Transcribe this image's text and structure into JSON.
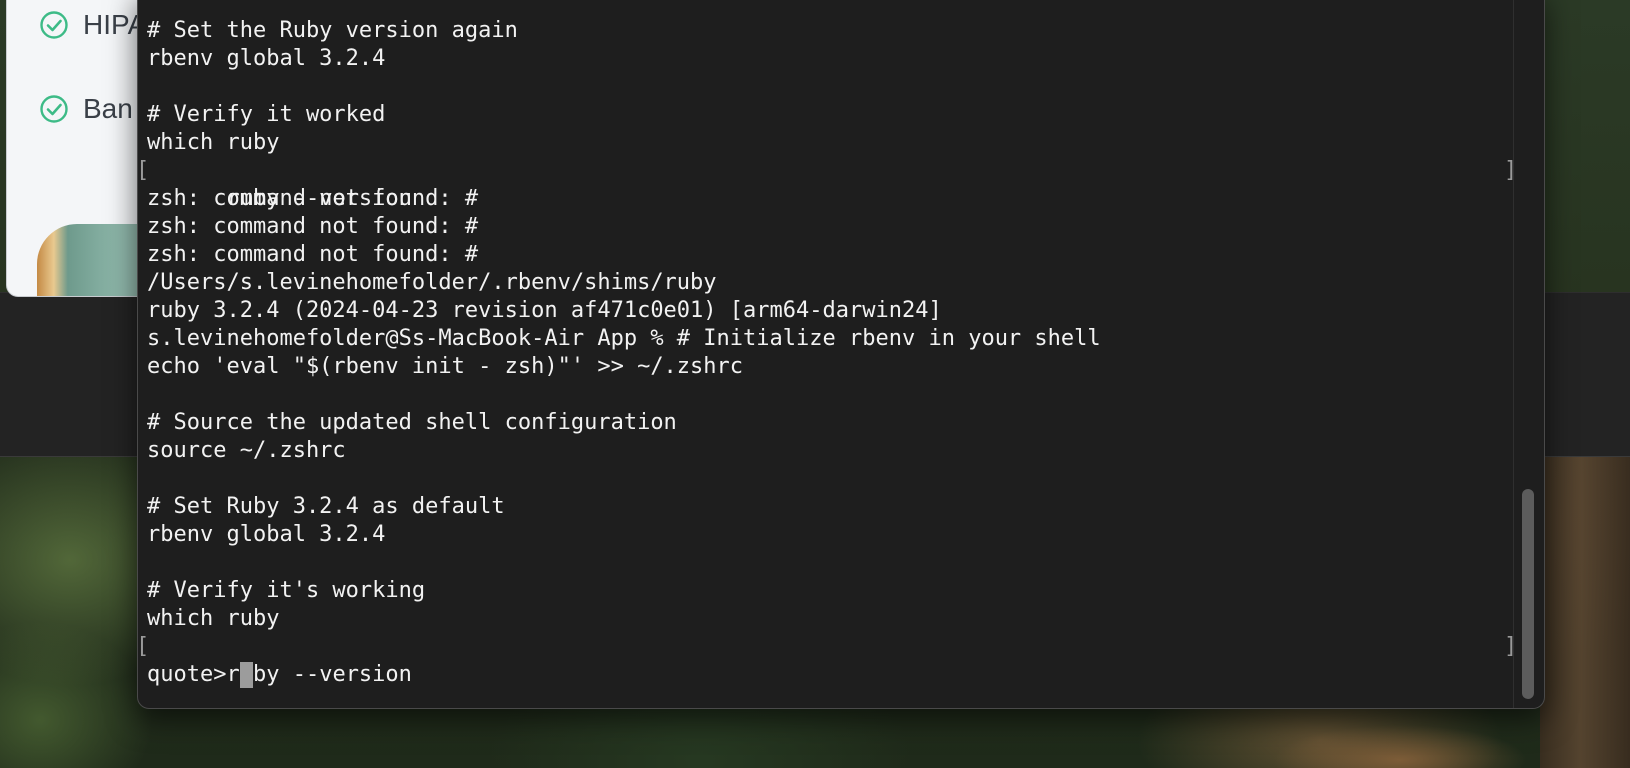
{
  "background_app": {
    "items": [
      {
        "label": "HIPA",
        "icon": "check-circle-icon"
      },
      {
        "label": "Ban",
        "icon": "check-circle-icon"
      }
    ],
    "accent_color": "#3dbb87"
  },
  "terminal": {
    "lines": [
      {
        "text": "# Set the Ruby version again"
      },
      {
        "text": "rbenv global 3.2.4"
      },
      {
        "text": ""
      },
      {
        "text": "# Verify it worked"
      },
      {
        "text": "which ruby"
      },
      {
        "text": "ruby --version",
        "marked": true
      },
      {
        "text": "zsh: command not found: #"
      },
      {
        "text": "zsh: command not found: #"
      },
      {
        "text": "zsh: command not found: #"
      },
      {
        "text": "/Users/s.levinehomefolder/.rbenv/shims/ruby"
      },
      {
        "text": "ruby 3.2.4 (2024-04-23 revision af471c0e01) [arm64-darwin24]"
      },
      {
        "text": "s.levinehomefolder@Ss-MacBook-Air App % # Initialize rbenv in your shell"
      },
      {
        "text": "echo 'eval \"$(rbenv init - zsh)\"' >> ~/.zshrc"
      },
      {
        "text": ""
      },
      {
        "text": "# Source the updated shell configuration"
      },
      {
        "text": "source ~/.zshrc"
      },
      {
        "text": ""
      },
      {
        "text": "# Set Ruby 3.2.4 as default"
      },
      {
        "text": "rbenv global 3.2.4"
      },
      {
        "text": ""
      },
      {
        "text": "# Verify it's working"
      },
      {
        "text": "which ruby"
      },
      {
        "text": "ruby --version",
        "marked": true
      }
    ],
    "prompt": "quote>",
    "bracket_left": "[",
    "bracket_right": "]",
    "colors": {
      "background": "#1e1e1e",
      "foreground": "#f2f2f2",
      "cursor": "#9c9c9c"
    }
  }
}
